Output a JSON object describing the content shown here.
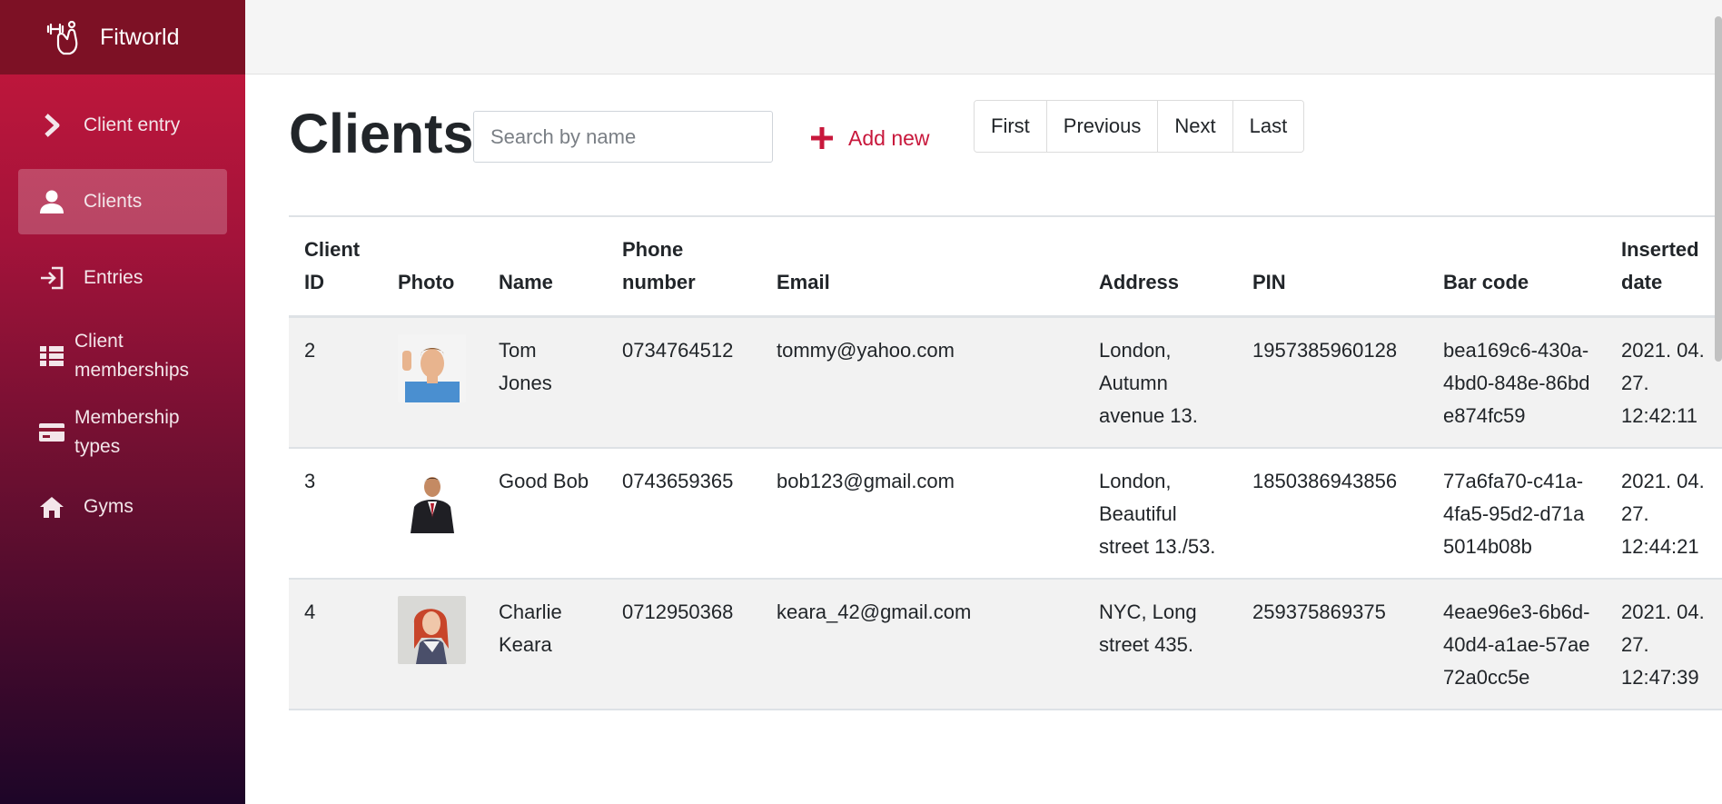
{
  "app": {
    "name": "Fitworld"
  },
  "sidebar": {
    "items": [
      {
        "label": "Client entry",
        "icon": "chevron-right-icon",
        "active": false
      },
      {
        "label": "Clients",
        "icon": "person-icon",
        "active": true
      },
      {
        "label": "Entries",
        "icon": "sign-in-icon",
        "active": false
      },
      {
        "label": "Client memberships",
        "icon": "list-icon",
        "active": false
      },
      {
        "label": "Membership types",
        "icon": "credit-card-icon",
        "active": false
      },
      {
        "label": "Gyms",
        "icon": "home-icon",
        "active": false
      }
    ]
  },
  "page": {
    "title": "Clients",
    "search_placeholder": "Search by name",
    "add_new_label": "Add new"
  },
  "pager": {
    "first": "First",
    "previous": "Previous",
    "next": "Next",
    "last": "Last"
  },
  "table": {
    "headers": {
      "client_id": "Client ID",
      "photo": "Photo",
      "name": "Name",
      "phone": "Phone number",
      "email": "Email",
      "address": "Address",
      "pin": "PIN",
      "bar_code": "Bar code",
      "inserted": "Inserted date"
    },
    "rows": [
      {
        "id": "2",
        "photo": "photo-man-waving",
        "name": "Tom Jones",
        "phone": "0734764512",
        "email": "tommy@yahoo.com",
        "address": "London, Autumn avenue 13.",
        "pin": "1957385960128",
        "bar_code": "bea169c6-430a-4bd0-848e-86bde874fc59",
        "inserted": "2021. 04. 27. 12:42:11"
      },
      {
        "id": "3",
        "photo": "photo-man-suit",
        "name": "Good Bob",
        "phone": "0743659365",
        "email": "bob123@gmail.com",
        "address": "London, Beautiful street 13./53.",
        "pin": "1850386943856",
        "bar_code": "77a6fa70-c41a-4fa5-95d2-d71a5014b08b",
        "inserted": "2021. 04. 27. 12:44:21"
      },
      {
        "id": "4",
        "photo": "photo-woman-redhair",
        "name": "Charlie Keara",
        "phone": "0712950368",
        "email": "keara_42@gmail.com",
        "address": "NYC, Long street 435.",
        "pin": "259375869375",
        "bar_code": "4eae96e3-6b6d-40d4-a1ae-57ae72a0cc5e",
        "inserted": "2021. 04. 27. 12:47:39"
      }
    ]
  },
  "colors": {
    "accent": "#c8183c",
    "sidebar_top": "#c8183c",
    "sidebar_bottom": "#1d0528",
    "brand_bar": "#7d1125"
  }
}
